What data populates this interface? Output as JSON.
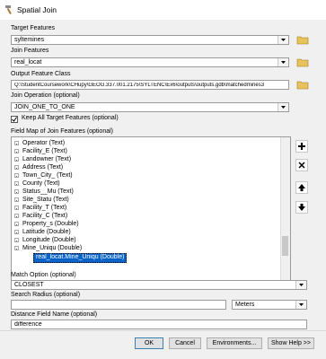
{
  "window": {
    "title": "Spatial Join"
  },
  "target_features": {
    "label": "Target Features",
    "value": "syltemines"
  },
  "join_features": {
    "label": "Join Features",
    "value": "real_locat"
  },
  "output_feature_class": {
    "label": "Output Feature Class",
    "value": "Q:\\StudentCoursework\\CHupy\\GEOG.337.001.2175\\SYLTENC\\Ex6\\outputs\\outputs.gdb\\matchedmines3"
  },
  "join_operation": {
    "label": "Join Operation (optional)",
    "value": "JOIN_ONE_TO_ONE"
  },
  "keep_all": {
    "label": "Keep All Target Features (optional)",
    "checked": true
  },
  "field_map": {
    "label": "Field Map of Join Features (optional)",
    "items": [
      "Operator (Text)",
      "Facility_E (Text)",
      "Landowner (Text)",
      "Address (Text)",
      "Town_City_ (Text)",
      "County (Text)",
      "Status__Mu (Text)",
      "Site_Statu (Text)",
      "Facility_T (Text)",
      "Facility_C (Text)",
      "Property_s (Double)",
      "Latitude (Double)",
      "Longitude (Double)",
      "Mine_Uniqu (Double)"
    ],
    "selected_child": "real_locat.Mine_Uniqu (Double)"
  },
  "match_option": {
    "label": "Match Option (optional)",
    "value": "CLOSEST"
  },
  "search_radius": {
    "label": "Search Radius (optional)",
    "value": "",
    "units": "Meters"
  },
  "distance_field": {
    "label": "Distance Field Name (optional)",
    "value": "difference"
  },
  "buttons": {
    "ok": "OK",
    "cancel": "Cancel",
    "environments": "Environments...",
    "show_help": "Show Help >>"
  }
}
